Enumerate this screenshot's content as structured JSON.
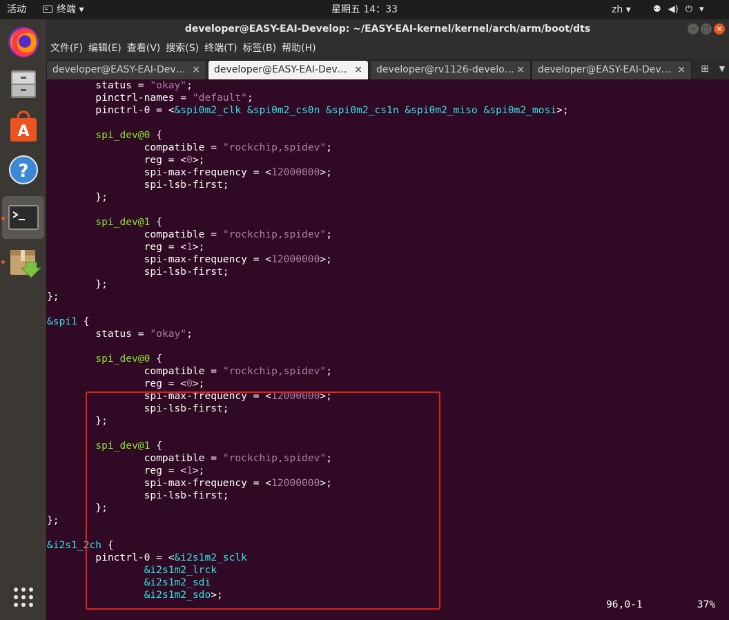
{
  "topbar": {
    "activities": "活动",
    "app_menu": "终端",
    "clock": "星期五 14：33",
    "lang": "zh",
    "tray_network": "⚉",
    "tray_volume": "◀)",
    "tray_power": "⏻"
  },
  "window": {
    "title": "developer@EASY-EAI-Develop: ~/EASY-EAI-kernel/kernel/arch/arm/boot/dts",
    "menu": [
      "文件(F)",
      "编辑(E)",
      "查看(V)",
      "搜索(S)",
      "终端(T)",
      "标签(B)",
      "帮助(H)"
    ],
    "tabs": [
      {
        "label": "developer@EASY-EAI-Devel…",
        "active": false
      },
      {
        "label": "developer@EASY-EAI-Devel…",
        "active": true
      },
      {
        "label": "developer@rv1126-develo…",
        "active": false
      },
      {
        "label": "developer@EASY-EAI-Devel…",
        "active": false
      }
    ]
  },
  "terminal": {
    "lines": [
      [
        [
          "        status = ",
          ""
        ],
        [
          "\"okay\"",
          "k-str"
        ],
        [
          ";",
          ""
        ]
      ],
      [
        [
          "        pinctrl-names = ",
          ""
        ],
        [
          "\"default\"",
          "k-str"
        ],
        [
          ";",
          ""
        ]
      ],
      [
        [
          "        pinctrl-0 = <",
          ""
        ],
        [
          "&spi0m2_clk &spi0m2_cs0n &spi0m2_cs1n &spi0m2_miso &spi0m2_mosi",
          "k-ref"
        ],
        [
          ">;",
          ""
        ]
      ],
      [
        [
          "",
          ""
        ]
      ],
      [
        [
          "        ",
          ""
        ],
        [
          "spi_dev@0",
          "k-kw"
        ],
        [
          " {",
          ""
        ]
      ],
      [
        [
          "                compatible = ",
          ""
        ],
        [
          "\"rockchip,spidev\"",
          "k-str"
        ],
        [
          ";",
          ""
        ]
      ],
      [
        [
          "                reg = <",
          ""
        ],
        [
          "0",
          "k-num"
        ],
        [
          ">;",
          ""
        ]
      ],
      [
        [
          "                spi-max-frequency = <",
          ""
        ],
        [
          "12000000",
          "k-num"
        ],
        [
          ">;",
          ""
        ]
      ],
      [
        [
          "                spi-lsb-first;",
          ""
        ]
      ],
      [
        [
          "        };",
          ""
        ]
      ],
      [
        [
          "",
          ""
        ]
      ],
      [
        [
          "        ",
          ""
        ],
        [
          "spi_dev@1",
          "k-kw"
        ],
        [
          " {",
          ""
        ]
      ],
      [
        [
          "                compatible = ",
          ""
        ],
        [
          "\"rockchip,spidev\"",
          "k-str"
        ],
        [
          ";",
          ""
        ]
      ],
      [
        [
          "                reg = <",
          ""
        ],
        [
          "1",
          "k-num"
        ],
        [
          ">;",
          ""
        ]
      ],
      [
        [
          "                spi-max-frequency = <",
          ""
        ],
        [
          "12000000",
          "k-num"
        ],
        [
          ">;",
          ""
        ]
      ],
      [
        [
          "                spi-lsb-first;",
          ""
        ]
      ],
      [
        [
          "        };",
          ""
        ]
      ],
      [
        [
          "};",
          ""
        ]
      ],
      [
        [
          "",
          ""
        ]
      ],
      [
        [
          "&spi1",
          "k-node"
        ],
        [
          " {",
          ""
        ]
      ],
      [
        [
          "        status = ",
          ""
        ],
        [
          "\"okay\"",
          "k-str"
        ],
        [
          ";",
          ""
        ]
      ],
      [
        [
          "",
          ""
        ]
      ],
      [
        [
          "        ",
          ""
        ],
        [
          "spi_dev@0",
          "k-kw"
        ],
        [
          " {",
          ""
        ]
      ],
      [
        [
          "                compatible = ",
          ""
        ],
        [
          "\"rockchip,spidev\"",
          "k-str"
        ],
        [
          ";",
          ""
        ]
      ],
      [
        [
          "                reg = <",
          ""
        ],
        [
          "0",
          "k-num"
        ],
        [
          ">;",
          ""
        ]
      ],
      [
        [
          "                spi-max-frequency = <",
          ""
        ],
        [
          "12000000",
          "k-num"
        ],
        [
          ">;",
          ""
        ]
      ],
      [
        [
          "                spi-lsb-first;",
          ""
        ]
      ],
      [
        [
          "        };",
          ""
        ]
      ],
      [
        [
          "",
          ""
        ]
      ],
      [
        [
          "        ",
          ""
        ],
        [
          "spi_dev@1",
          "k-kw"
        ],
        [
          " {",
          ""
        ]
      ],
      [
        [
          "                compatible = ",
          ""
        ],
        [
          "\"rockchip,spidev\"",
          "k-str"
        ],
        [
          ";",
          ""
        ]
      ],
      [
        [
          "                reg = <",
          ""
        ],
        [
          "1",
          "k-num"
        ],
        [
          ">;",
          ""
        ]
      ],
      [
        [
          "                spi-max-frequency = <",
          ""
        ],
        [
          "12000000",
          "k-num"
        ],
        [
          ">;",
          ""
        ]
      ],
      [
        [
          "                spi-lsb-first;",
          ""
        ]
      ],
      [
        [
          "        };",
          ""
        ]
      ],
      [
        [
          "};",
          ""
        ]
      ],
      [
        [
          "",
          ""
        ]
      ],
      [
        [
          "&i2s1_2ch",
          "k-node"
        ],
        [
          " {",
          ""
        ]
      ],
      [
        [
          "        pinctrl-0 = <",
          ""
        ],
        [
          "&i2s1m2_sclk",
          "k-ref"
        ]
      ],
      [
        [
          "                ",
          ""
        ],
        [
          "&i2s1m2_lrck",
          "k-ref"
        ]
      ],
      [
        [
          "                ",
          ""
        ],
        [
          "&i2s1m2_sdi",
          "k-ref"
        ]
      ],
      [
        [
          "                ",
          ""
        ],
        [
          "&i2s1m2_sdo",
          "k-ref"
        ],
        [
          ">;",
          ""
        ]
      ]
    ],
    "cursor_position": "96,0-1",
    "scroll_percent": "37%"
  },
  "colors": {
    "terminal_bg": "#300a24",
    "highlight_border": "#e0201b",
    "string": "#ad7fa8",
    "reference": "#34e2e2",
    "keyword": "#8ae234",
    "ubuntu_orange": "#e95420"
  },
  "dock": {
    "icons": [
      "firefox-icon",
      "files-icon",
      "software-center-icon",
      "help-icon",
      "terminal-icon",
      "archive-manager-icon",
      "show-apps-icon"
    ]
  }
}
